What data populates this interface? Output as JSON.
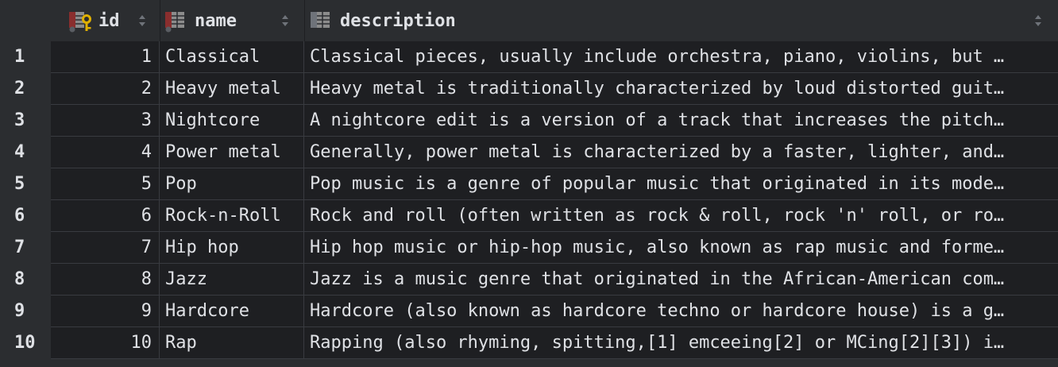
{
  "columns": {
    "id": {
      "label": "id",
      "icon": "primary-key-column-icon"
    },
    "name": {
      "label": "name",
      "icon": "column-icon"
    },
    "description": {
      "label": "description",
      "icon": "column-icon"
    }
  },
  "rows": [
    {
      "num": "1",
      "id": "1",
      "name": "Classical",
      "description": "Classical pieces, usually include orchestra, piano, violins, but …"
    },
    {
      "num": "2",
      "id": "2",
      "name": "Heavy metal",
      "description": "Heavy metal is traditionally characterized by loud distorted guit…"
    },
    {
      "num": "3",
      "id": "3",
      "name": "Nightcore",
      "description": "A nightcore edit is a version of a track that increases the pitch…"
    },
    {
      "num": "4",
      "id": "4",
      "name": "Power metal",
      "description": "Generally, power metal is characterized by a faster, lighter, and…"
    },
    {
      "num": "5",
      "id": "5",
      "name": "Pop",
      "description": "Pop music is a genre of popular music that originated in its mode…"
    },
    {
      "num": "6",
      "id": "6",
      "name": "Rock-n-Roll",
      "description": "Rock and roll (often written as rock & roll, rock 'n' roll, or ro…"
    },
    {
      "num": "7",
      "id": "7",
      "name": "Hip hop",
      "description": "Hip hop music or hip-hop music, also known as rap music and forme…"
    },
    {
      "num": "8",
      "id": "8",
      "name": "Jazz",
      "description": "Jazz is a music genre that originated in the African-American com…"
    },
    {
      "num": "9",
      "id": "9",
      "name": "Hardcore",
      "description": "Hardcore (also known as hardcore techno or hardcore house) is a g…"
    },
    {
      "num": "10",
      "id": "10",
      "name": "Rap",
      "description": "Rapping (also rhyming, spitting,[1] emceeing[2] or MCing[2][3]) i…"
    }
  ],
  "colors": {
    "background": "#1e1f22",
    "header": "#2b2d30",
    "text": "#dfe1e5",
    "gridline": "#393b40",
    "key_icon": "#e0b000",
    "column_icon": "#8c8c8c",
    "column_icon_marker": "#8a2e2e"
  }
}
